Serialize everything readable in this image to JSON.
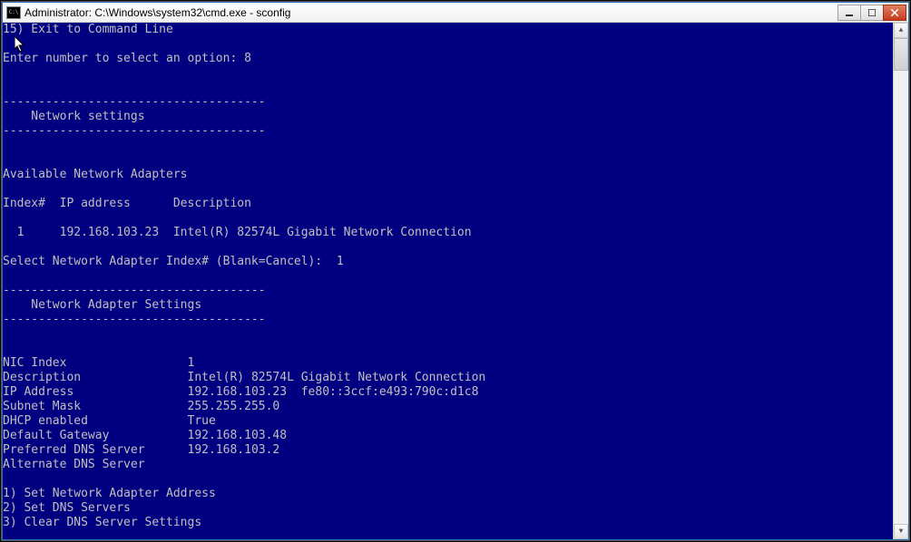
{
  "window": {
    "title": "Administrator: C:\\Windows\\system32\\cmd.exe - sconfig"
  },
  "terminal": {
    "exit_line": "15) Exit to Command Line",
    "prompt_select_option": "Enter number to select an option: 8",
    "divider": "-------------------------------------",
    "section_network_settings": "    Network settings",
    "available_adapters_title": "Available Network Adapters",
    "adapter_table_header": "Index#  IP address      Description",
    "adapter_row": "  1     192.168.103.23  Intel(R) 82574L Gigabit Network Connection",
    "select_adapter_prompt": "Select Network Adapter Index# (Blank=Cancel):  1",
    "section_adapter_settings": "    Network Adapter Settings",
    "nic_index_label": "NIC Index                 ",
    "nic_index_value": "1",
    "description_label": "Description               ",
    "description_value": "Intel(R) 82574L Gigabit Network Connection",
    "ip_address_label": "IP Address                ",
    "ip_address_value": "192.168.103.23  fe80::3ccf:e493:790c:d1c8",
    "subnet_mask_label": "Subnet Mask               ",
    "subnet_mask_value": "255.255.255.0",
    "dhcp_enabled_label": "DHCP enabled              ",
    "dhcp_enabled_value": "True",
    "default_gateway_label": "Default Gateway           ",
    "default_gateway_value": "192.168.103.48",
    "preferred_dns_label": "Preferred DNS Server      ",
    "preferred_dns_value": "192.168.103.2",
    "alternate_dns_label": "Alternate DNS Server",
    "menu_1": "1) Set Network Adapter Address",
    "menu_2": "2) Set DNS Servers",
    "menu_3": "3) Clear DNS Server Settings"
  }
}
